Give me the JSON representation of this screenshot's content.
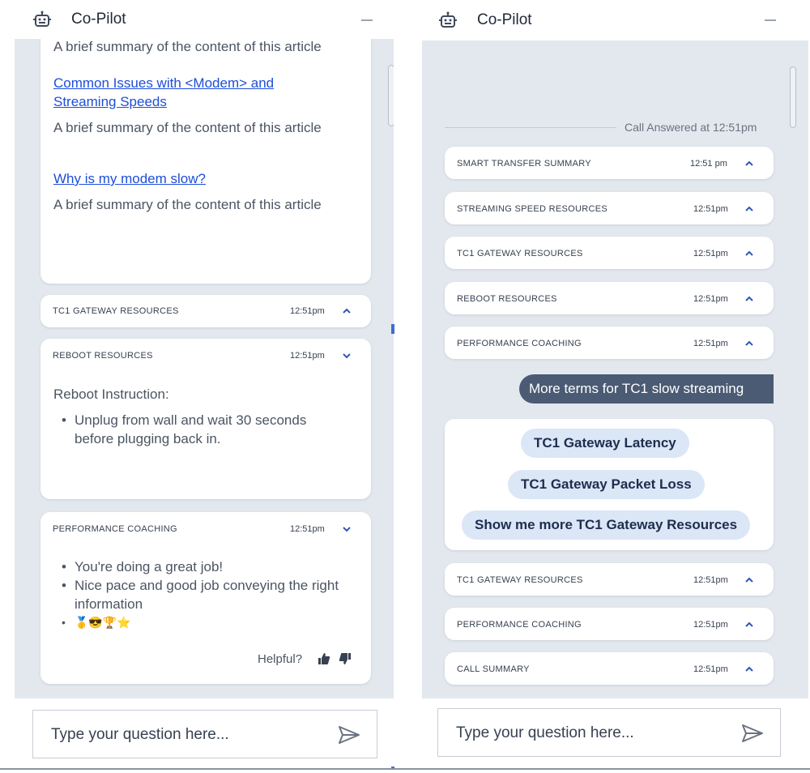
{
  "app": {
    "title": "Co-Pilot"
  },
  "left": {
    "article_card": {
      "top_summary": "A brief summary of the content of this article",
      "articles": [
        {
          "title": "Common Issues with <Modem> and Streaming Speeds",
          "summary": "A brief summary of the content of this article"
        },
        {
          "title": "Why is my modem slow?",
          "summary": "A brief summary of the content of this article"
        }
      ]
    },
    "tc1_row": {
      "label": "TC1 GATEWAY RESOURCES",
      "time": "12:51pm"
    },
    "reboot": {
      "label": "REBOOT RESOURCES",
      "time": "12:51pm",
      "heading": "Reboot Instruction:",
      "bullets": [
        "Unplug from wall and wait 30 seconds before plugging back in."
      ]
    },
    "coaching": {
      "label": "PERFORMANCE COACHING",
      "time": "12:51pm",
      "bullets": [
        "You're doing a great job!",
        "Nice pace and good job conveying the right information"
      ],
      "emojis": "🥇😎🏆⭐",
      "helpful_label": "Helpful?"
    }
  },
  "right": {
    "call_answered": "Call Answered at 12:51pm",
    "rows_top": [
      {
        "label": "SMART TRANSFER SUMMARY",
        "time": "12:51 pm"
      },
      {
        "label": "STREAMING SPEED RESOURCES",
        "time": "12:51pm"
      },
      {
        "label": "TC1 GATEWAY RESOURCES",
        "time": "12:51pm"
      },
      {
        "label": "REBOOT RESOURCES",
        "time": "12:51pm"
      },
      {
        "label": "PERFORMANCE COACHING",
        "time": "12:51pm"
      }
    ],
    "user_message": "More terms for TC1 slow streaming",
    "suggestions": [
      "TC1 Gateway Latency",
      "TC1 Gateway Packet Loss",
      "Show me more TC1 Gateway Resources"
    ],
    "rows_bottom": [
      {
        "label": "TC1 GATEWAY RESOURCES",
        "time": "12:51pm"
      },
      {
        "label": "PERFORMANCE COACHING",
        "time": "12:51pm"
      },
      {
        "label": "CALL SUMMARY",
        "time": "12:51pm"
      }
    ]
  },
  "input": {
    "placeholder": "Type your question here..."
  },
  "icons": {
    "bot": "robot-icon",
    "send": "send-icon",
    "expand": "chevron-up-icon",
    "collapse": "chevron-down-icon",
    "thumbs_up": "thumbs-up-icon",
    "thumbs_down": "thumbs-down-icon"
  },
  "colors": {
    "panel_bg": "#e3e8ef",
    "link": "#1d4ed8",
    "user_bubble": "#4a5b73",
    "chip_bg": "#dbe6f7",
    "accent": "#3b6fd6"
  }
}
